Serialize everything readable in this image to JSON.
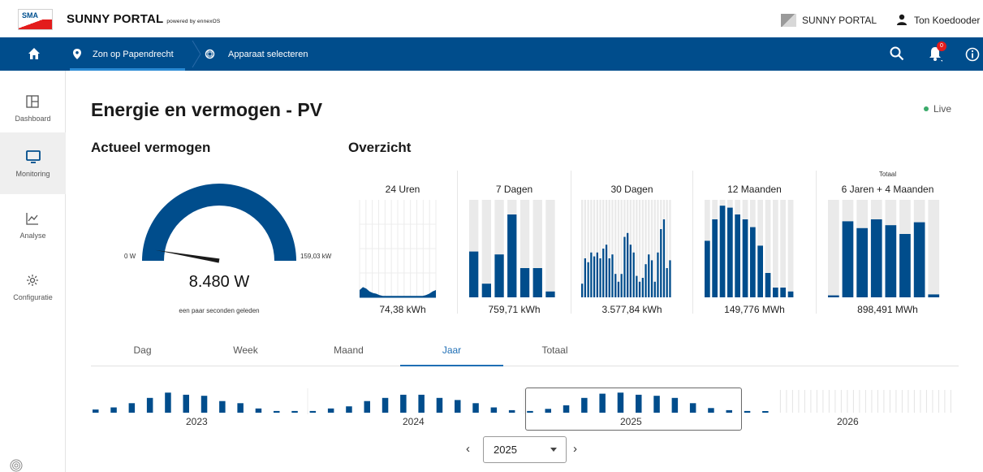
{
  "header": {
    "brand": "SUNNY PORTAL",
    "brand_sub": "powered by ennexOS",
    "logo_text": "SMA",
    "portal_link": "SUNNY PORTAL",
    "user_name": "Ton Koedooder"
  },
  "nav": {
    "plant": "Zon op Papendrecht",
    "device": "Apparaat selecteren",
    "notification_count": "0"
  },
  "sidebar": {
    "items": [
      {
        "label": "Dashboard",
        "icon": "dashboard-icon"
      },
      {
        "label": "Monitoring",
        "icon": "monitor-icon"
      },
      {
        "label": "Analyse",
        "icon": "chart-icon"
      },
      {
        "label": "Configuratie",
        "icon": "gear-icon"
      }
    ]
  },
  "main": {
    "title": "Energie en vermogen - PV",
    "live_label": "Live",
    "current_power_heading": "Actueel vermogen",
    "overview_heading": "Overzicht"
  },
  "gauge": {
    "min_label": "0 W",
    "max_label": "159,03 kW",
    "value": "8.480 W",
    "updated": "een paar seconden geleden",
    "fraction": 0.053
  },
  "overview": [
    {
      "pre": "",
      "label": "24 Uren",
      "value": "74,38 kWh"
    },
    {
      "pre": "",
      "label": "7 Dagen",
      "value": "759,71 kWh"
    },
    {
      "pre": "",
      "label": "30 Dagen",
      "value": "3.577,84 kWh"
    },
    {
      "pre": "",
      "label": "12 Maanden",
      "value": "149,776 MWh"
    },
    {
      "pre": "Totaal",
      "label": "6 Jaren + 4 Maanden",
      "value": "898,491 MWh"
    }
  ],
  "tabs": [
    "Dag",
    "Week",
    "Maand",
    "Jaar",
    "Totaal"
  ],
  "active_tab": "Jaar",
  "timeline": {
    "years": [
      "2023",
      "2024",
      "2025",
      "2026"
    ],
    "selected_year": "2025"
  },
  "colors": {
    "brand_blue": "#004d8c",
    "bar_blue": "#004d8c",
    "bar_bg": "#eaeaea",
    "live_green": "#3aaa6a"
  },
  "chart_data": [
    {
      "type": "area",
      "name": "24 Uren",
      "values": [
        0.1,
        0.14,
        0.12,
        0.08,
        0.06,
        0.05,
        0.03,
        0.02,
        0.02,
        0.02,
        0.02,
        0.02,
        0.02,
        0.02,
        0.02,
        0.02,
        0.02,
        0.02,
        0.02,
        0.02,
        0.03,
        0.05,
        0.08,
        0.1
      ]
    },
    {
      "type": "bar",
      "name": "7 Dagen",
      "values": [
        0.47,
        0.14,
        0.44,
        0.85,
        0.3,
        0.3,
        0.06
      ]
    },
    {
      "type": "bar",
      "name": "30 Dagen",
      "values": [
        0.14,
        0.4,
        0.36,
        0.46,
        0.42,
        0.46,
        0.4,
        0.5,
        0.54,
        0.4,
        0.44,
        0.24,
        0.16,
        0.24,
        0.62,
        0.66,
        0.54,
        0.46,
        0.22,
        0.16,
        0.2,
        0.34,
        0.44,
        0.38,
        0.16,
        0.46,
        0.7,
        0.8,
        0.3,
        0.38
      ]
    },
    {
      "type": "bar",
      "name": "12 Maanden",
      "values": [
        0.58,
        0.8,
        0.94,
        0.92,
        0.85,
        0.8,
        0.72,
        0.53,
        0.25,
        0.1,
        0.1,
        0.06
      ]
    },
    {
      "type": "bar",
      "name": "Totaal",
      "values": [
        0.02,
        0.78,
        0.71,
        0.8,
        0.74,
        0.65,
        0.77,
        0.03
      ]
    },
    {
      "type": "bar",
      "name": "Jaar tijdlijn",
      "values": [
        0.15,
        0.25,
        0.45,
        0.7,
        0.95,
        0.85,
        0.8,
        0.55,
        0.45,
        0.2,
        0.08,
        0.08,
        0.08,
        0.2,
        0.3,
        0.55,
        0.7,
        0.85,
        0.85,
        0.7,
        0.6,
        0.45,
        0.25,
        0.12,
        0.08,
        0.18,
        0.35,
        0.7,
        0.9,
        0.95,
        0.85,
        0.8,
        0.7,
        0.45,
        0.22,
        0.12,
        0.08,
        0.03
      ]
    }
  ]
}
